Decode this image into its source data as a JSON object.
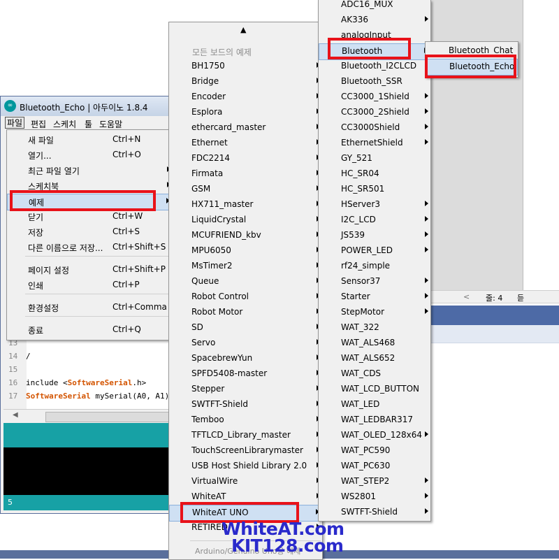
{
  "ide": {
    "title": "Bluetooth_Echo | 아두이노 1.8.4",
    "logo_glyph": "∞",
    "menubar": [
      "파일",
      "편집",
      "스케치",
      "툴",
      "도움말"
    ],
    "code_lines": [
      {
        "num": "13",
        "text": ""
      },
      {
        "num": "14",
        "text": "/"
      },
      {
        "num": "15",
        "text": ""
      },
      {
        "num": "16",
        "pre": "include <",
        "kw": "SoftwareSerial",
        "post": ".h>"
      },
      {
        "num": "17",
        "pre": "",
        "kw": "SoftwareSerial",
        "post": " mySerial(A0, A1);"
      }
    ],
    "status_line": "5"
  },
  "background": {
    "status_chevron": "<",
    "status_lines": "줄: 4",
    "status_cut": "듣"
  },
  "file_menu": {
    "items": [
      {
        "label": "새 파일",
        "shortcut": "Ctrl+N"
      },
      {
        "label": "열기...",
        "shortcut": "Ctrl+O"
      },
      {
        "label": "최근 파일 열기",
        "shortcut": "",
        "submenu": true
      },
      {
        "label": "스케치북",
        "shortcut": "",
        "submenu": true
      },
      {
        "label": "예제",
        "shortcut": "",
        "submenu": true
      },
      {
        "label": "닫기",
        "shortcut": "Ctrl+W"
      },
      {
        "label": "저장",
        "shortcut": "Ctrl+S"
      },
      {
        "label": "다른 이름으로 저장...",
        "shortcut": "Ctrl+Shift+S"
      },
      {
        "label": "페이지 설정",
        "shortcut": "Ctrl+Shift+P"
      },
      {
        "label": "인쇄",
        "shortcut": "Ctrl+P"
      },
      {
        "label": "환경설정",
        "shortcut": "Ctrl+Comma"
      },
      {
        "label": "종료",
        "shortcut": "Ctrl+Q"
      }
    ]
  },
  "examples_menu": {
    "scroll_up_arrow": "▲",
    "section_header": "모든 보드의 예제",
    "items": [
      "BH1750",
      "Bridge",
      "Encoder",
      "Esplora",
      "ethercard_master",
      "Ethernet",
      "FDC2214",
      "Firmata",
      "GSM",
      "HX711_master",
      "LiquidCrystal",
      "MCUFRIEND_kbv",
      "MPU6050",
      "MsTimer2",
      "Queue",
      "Robot Control",
      "Robot Motor",
      "SD",
      "Servo",
      "SpacebrewYun",
      "SPFD5408-master",
      "Stepper",
      "SWTFT-Shield",
      "Temboo",
      "TFTLCD_Library_master",
      "TouchScreenLibrarymaster",
      "USB Host Shield Library 2.0",
      "VirtualWire",
      "WhiteAT",
      "WhiteAT UNO",
      "RETIRED"
    ],
    "footer": "Arduino/Genuino Uno용 예제"
  },
  "whiteat_menu": {
    "items": [
      {
        "label": "ADC16_MUX",
        "submenu": false
      },
      {
        "label": "AK336",
        "submenu": true
      },
      {
        "label": "analogInput",
        "submenu": false
      },
      {
        "label": "Bluetooth",
        "submenu": true
      },
      {
        "label": "Bluetooth_I2CLCD",
        "submenu": false
      },
      {
        "label": "Bluetooth_SSR",
        "submenu": false
      },
      {
        "label": "CC3000_1Shield",
        "submenu": true
      },
      {
        "label": "CC3000_2Shield",
        "submenu": true
      },
      {
        "label": "CC3000Shield",
        "submenu": true
      },
      {
        "label": "EthernetShield",
        "submenu": true
      },
      {
        "label": "GY_521",
        "submenu": false
      },
      {
        "label": "HC_SR04",
        "submenu": false
      },
      {
        "label": "HC_SR501",
        "submenu": false
      },
      {
        "label": "HServer3",
        "submenu": true
      },
      {
        "label": "I2C_LCD",
        "submenu": true
      },
      {
        "label": "JS539",
        "submenu": true
      },
      {
        "label": "POWER_LED",
        "submenu": true
      },
      {
        "label": "rf24_simple",
        "submenu": false
      },
      {
        "label": "Sensor37",
        "submenu": true
      },
      {
        "label": "Starter",
        "submenu": true
      },
      {
        "label": "StepMotor",
        "submenu": true
      },
      {
        "label": "WAT_322",
        "submenu": false
      },
      {
        "label": "WAT_ALS468",
        "submenu": false
      },
      {
        "label": "WAT_ALS652",
        "submenu": false
      },
      {
        "label": "WAT_CDS",
        "submenu": false
      },
      {
        "label": "WAT_LCD_BUTTON",
        "submenu": false
      },
      {
        "label": "WAT_LED",
        "submenu": false
      },
      {
        "label": "WAT_LEDBAR317",
        "submenu": false
      },
      {
        "label": "WAT_OLED_128x64",
        "submenu": true
      },
      {
        "label": "WAT_PC590",
        "submenu": false
      },
      {
        "label": "WAT_PC630",
        "submenu": false
      },
      {
        "label": "WAT_STEP2",
        "submenu": true
      },
      {
        "label": "WS2801",
        "submenu": true
      },
      {
        "label": "SWTFT-Shield",
        "submenu": true
      }
    ]
  },
  "bluetooth_menu": {
    "items": [
      "Bluetooth_Chat",
      "Bluetooth_Echo"
    ]
  },
  "watermark": {
    "line1": "WhiteAT.com",
    "line2": "KIT128.com"
  },
  "colors": {
    "highlight_box": "#e8121a",
    "arduino_teal": "#17a1a5",
    "watermark": "#2a2acb"
  }
}
